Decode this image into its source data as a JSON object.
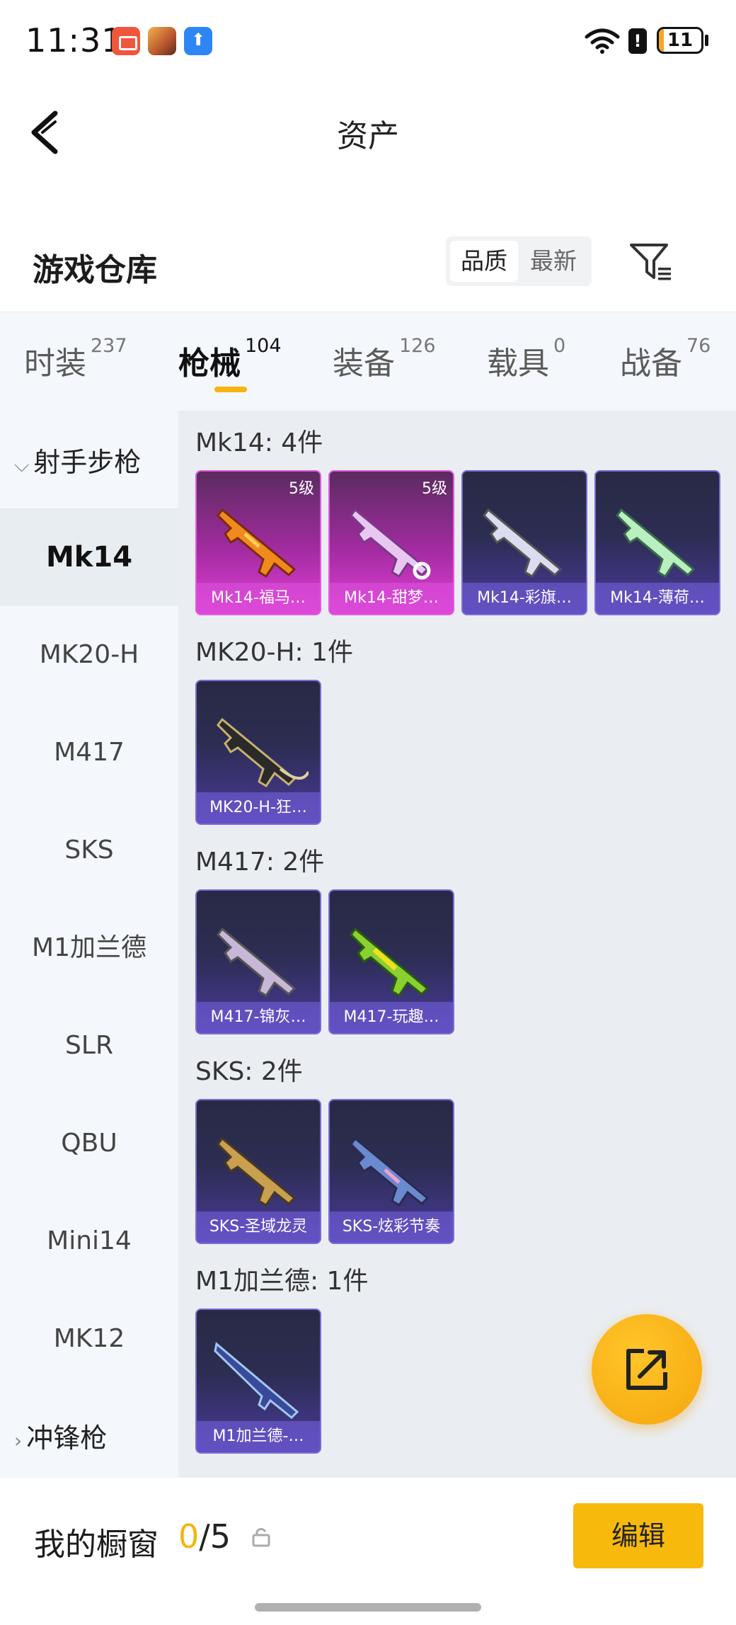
{
  "status": {
    "time": "11:31",
    "battery": "11",
    "battery_level": 0.11
  },
  "nav": {
    "title": "资产"
  },
  "warehouse": {
    "title": "游戏仓库",
    "sort_quality": "品质",
    "sort_latest": "最新"
  },
  "tabs": [
    {
      "label": "时装",
      "count": "237"
    },
    {
      "label": "枪械",
      "count": "104"
    },
    {
      "label": "装备",
      "count": "126"
    },
    {
      "label": "载具",
      "count": "0"
    },
    {
      "label": "战备",
      "count": "76"
    }
  ],
  "sidebar": {
    "group1": "射手步枪",
    "items": [
      "Mk14",
      "MK20-H",
      "M417",
      "SKS",
      "M1加兰德",
      "SLR",
      "QBU",
      "Mini14",
      "MK12"
    ],
    "group2": "冲锋枪"
  },
  "sections": [
    {
      "title": "Mk14: 4件",
      "cards": [
        {
          "name": "Mk14-福马…",
          "level": "5级"
        },
        {
          "name": "Mk14-甜梦…",
          "level": "5级"
        },
        {
          "name": "Mk14-彩旗…"
        },
        {
          "name": "Mk14-薄荷…"
        }
      ]
    },
    {
      "title": "MK20-H: 1件",
      "cards": [
        {
          "name": "MK20-H-狂…"
        }
      ]
    },
    {
      "title": "M417: 2件",
      "cards": [
        {
          "name": "M417-锦灰…"
        },
        {
          "name": "M417-玩趣…"
        }
      ]
    },
    {
      "title": "SKS: 2件",
      "cards": [
        {
          "name": "SKS-圣域龙灵"
        },
        {
          "name": "SKS-炫彩节奏"
        }
      ]
    },
    {
      "title": "M1加兰德: 1件",
      "cards": [
        {
          "name": "M1加兰德-…"
        }
      ]
    }
  ],
  "bottom": {
    "label": "我的橱窗",
    "current": "0",
    "total": "/5",
    "edit": "编辑"
  },
  "colors": {
    "accent": "#f5b40f",
    "legendary": "#e040d6",
    "epic": "#4a3a9c"
  },
  "icons": [
    "back-arrow-icon",
    "filter-icon",
    "share-icon",
    "lock-icon",
    "wifi-icon"
  ]
}
